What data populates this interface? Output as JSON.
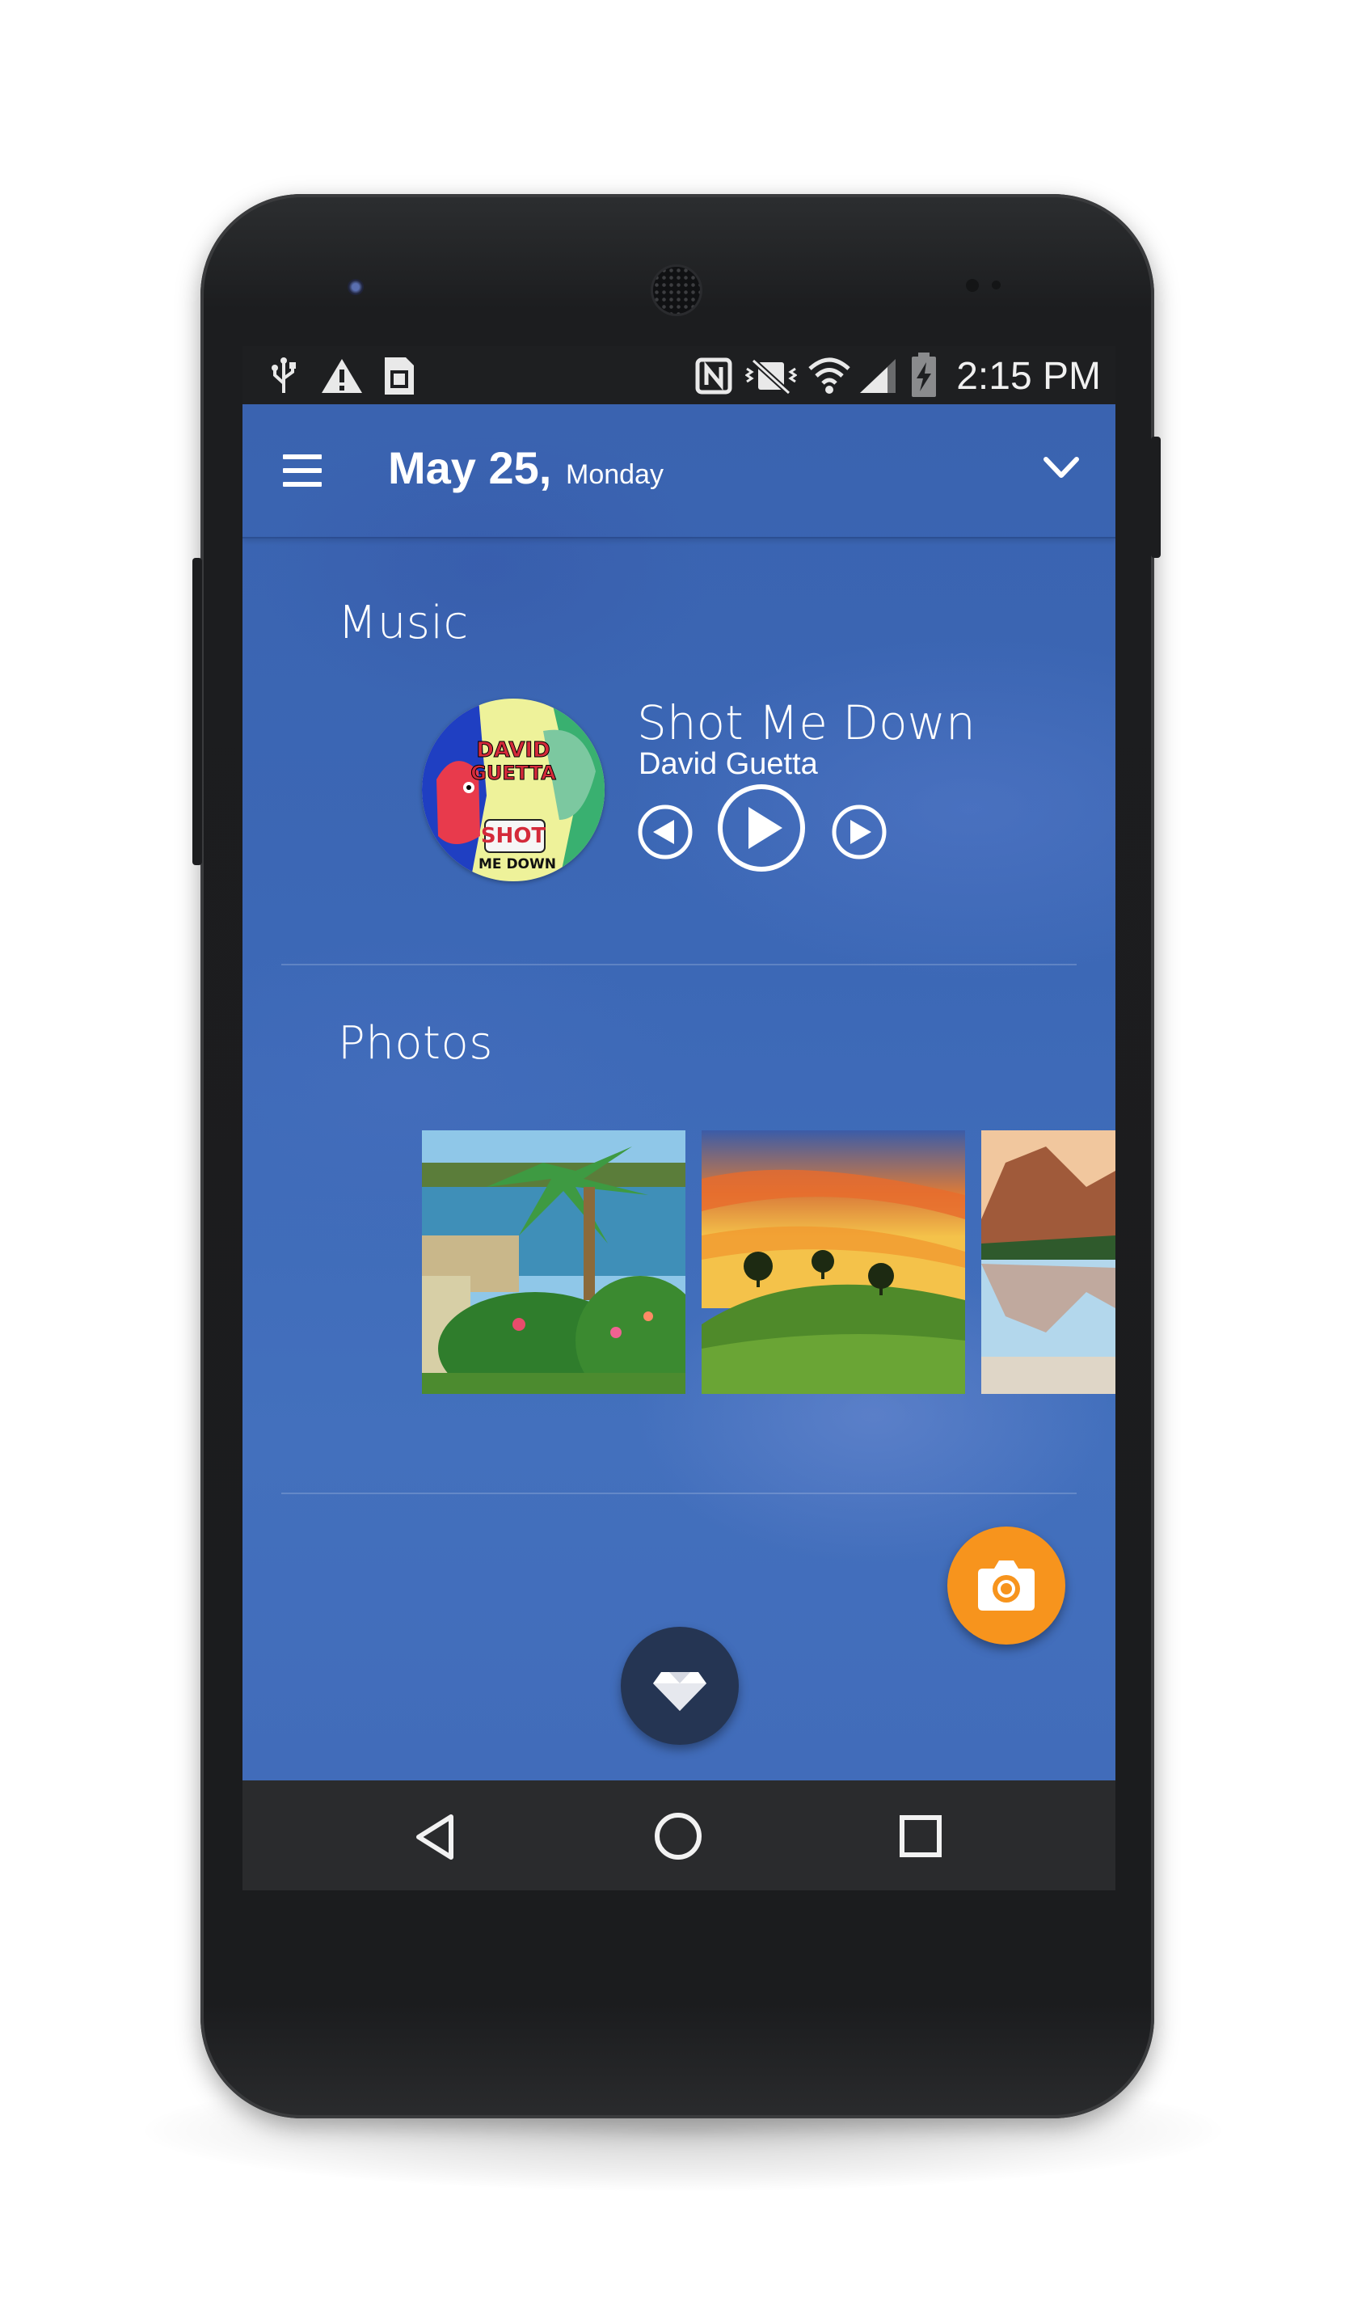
{
  "status_bar": {
    "time": "2:15 PM",
    "left_icons": [
      "usb-icon",
      "warning-icon",
      "sim-card-icon"
    ],
    "right_icons": [
      "nfc-icon",
      "vibrate-icon",
      "wifi-icon",
      "signal-icon",
      "battery-charging-icon"
    ]
  },
  "header": {
    "date": "May 25,",
    "weekday": "Monday",
    "menu_icon": "menu-icon",
    "expand_icon": "chevron-down-icon"
  },
  "music": {
    "section_title": "Music",
    "track_title": "Shot Me Down",
    "artist": "David Guetta",
    "album_art_text": [
      "DAVID",
      "GUETTA",
      "SHOT",
      "ME DOWN"
    ],
    "controls": [
      "previous-icon",
      "play-icon",
      "next-icon"
    ]
  },
  "photos": {
    "section_title": "Photos",
    "items": [
      "pool-garden-photo",
      "sunset-hills-photo",
      "mountain-lake-photo"
    ]
  },
  "fab": {
    "camera_icon": "camera-icon",
    "diamond_icon": "diamond-icon"
  },
  "colors": {
    "app_background": "#3d67b5",
    "fab_camera": "#f7941d",
    "fab_diamond": "#253553",
    "phone_body": "#1c1d1f"
  },
  "nav_bar": {
    "buttons": [
      "back-icon",
      "home-icon",
      "recents-icon"
    ]
  }
}
